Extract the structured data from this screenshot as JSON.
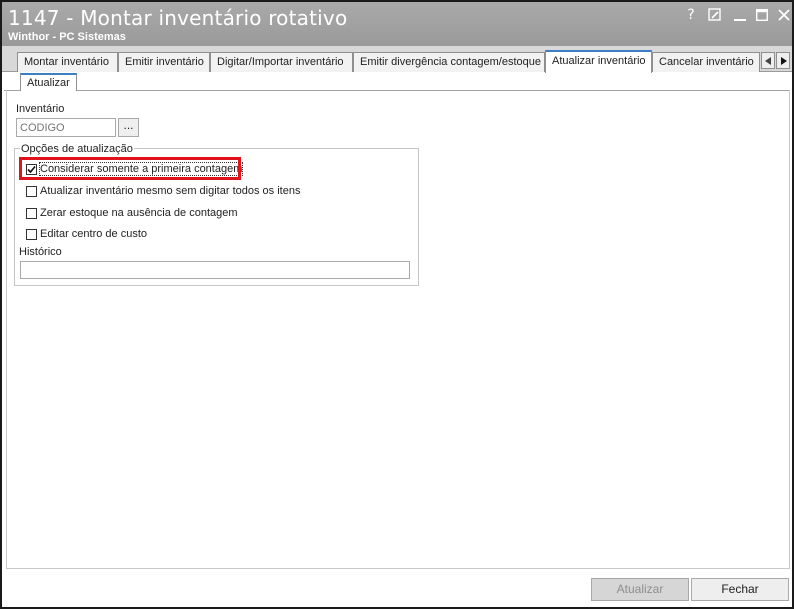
{
  "window": {
    "title": "1147 - Montar inventário rotativo",
    "subtitle": "Winthor - PC Sistemas",
    "controls": {
      "help": "?",
      "restore": "⬜",
      "minimize": "—",
      "maximize": "☐",
      "close": "✕"
    }
  },
  "tabs": [
    {
      "label": "Montar inventário"
    },
    {
      "label": "Emitir inventário"
    },
    {
      "label": "Digitar/Importar inventário"
    },
    {
      "label": "Emitir divergência contagem/estoque"
    },
    {
      "label": "Atualizar inventário",
      "active": true
    },
    {
      "label": "Cancelar inventário"
    }
  ],
  "subtabs": [
    {
      "label": "Atualizar"
    }
  ],
  "form": {
    "inventario_label": "Inventário",
    "inventario_placeholder": "CÓDIGO",
    "dots_label": "...",
    "group_title": "Opções de atualização",
    "options": [
      {
        "label": "Considerar somente a primeira contagem",
        "checked": true
      },
      {
        "label": "Atualizar inventário mesmo sem digitar todos os itens",
        "checked": false
      },
      {
        "label": "Zerar estoque na ausência de contagem",
        "checked": false
      },
      {
        "label": "Editar centro de custo",
        "checked": false
      }
    ],
    "historico_label": "Histórico",
    "historico_value": ""
  },
  "footer": {
    "atualizar_label": "Atualizar",
    "fechar_label": "Fechar"
  },
  "colors": {
    "titlebar": "#9e9e9e",
    "accent": "#3c7fc4",
    "highlight": "#e0121c"
  }
}
